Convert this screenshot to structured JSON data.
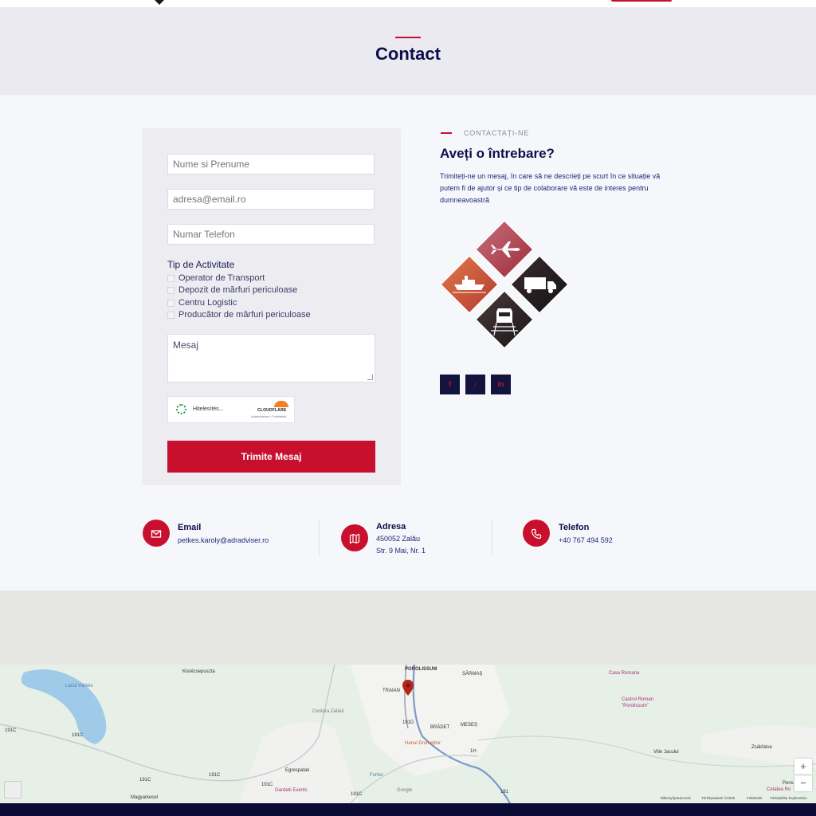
{
  "hero": {
    "title": "Contact"
  },
  "form": {
    "name_placeholder": "Nume si Prenume",
    "email_placeholder": "adresa@email.ro",
    "phone_placeholder": "Numar Telefon",
    "activity_label": "Tip de Activitate",
    "activities": [
      "Operator de Transport",
      "Depozit de mărfuri periculoase",
      "Centru Logistic",
      "Producător de mărfuri periculoase"
    ],
    "message_placeholder": "Mesaj",
    "captcha_text": "Hitelesítés...",
    "captcha_brand": "CLOUDFLARE",
    "captcha_links": "Adatvédelem • Feltételek",
    "submit_label": "Trimite Mesaj"
  },
  "contact_intro": {
    "kicker": "CONTACTAȚI-NE",
    "heading": "Aveți o întrebare?",
    "description": "Trimiteți-ne un mesaj, în care să ne descrieți pe scurt în ce situație vă putem fi de ajutor și ce tip de colaborare vă este de interes pentru dumneavoastră"
  },
  "social": [
    {
      "name": "facebook-icon",
      "glyph": "f"
    },
    {
      "name": "tiktok-icon",
      "glyph": "♪"
    },
    {
      "name": "linkedin-icon",
      "glyph": "in"
    }
  ],
  "info": {
    "email": {
      "title": "Email",
      "value": "petkes.karoly@adradviser.ro"
    },
    "address": {
      "title": "Adresa",
      "line1": "450052 Zalău",
      "line2": "Str. 9 Mai, Nr. 1"
    },
    "phone": {
      "title": "Telefon",
      "value": "+40 767 494 592"
    }
  },
  "map": {
    "labels": {
      "kisrecsepuszta": "Kisrécsepuszta",
      "lacul_varkes": "Lacul Várkés",
      "porolissum": "POROLISSUM",
      "sarmas": "ȘĂRMAȘ",
      "traian": "TRAIAN",
      "bradet": "BRĂDET",
      "meses": "MESEȘ",
      "casa_romana": "Casa Romana",
      "castrul": "Castrul Roman \"Porolissum\"",
      "hanul": "Hanul Drumeților",
      "viile": "Viile Jacului",
      "zsakfalva": "Zsákfalva",
      "egrespatak": "Egrespatak",
      "fortec": "Fortec",
      "gardelli": "Gardelli Events",
      "magyarkecel": "Magyarkecel",
      "google": "Google",
      "pens": "Pens",
      "cetatea": "Cetatea Ro",
      "centura": "Centura Zalăul"
    },
    "roads": [
      "191C",
      "191C",
      "191C",
      "191C",
      "191C",
      "191C",
      "191D",
      "1H",
      "191"
    ],
    "zoom_in": "+",
    "zoom_out": "−",
    "attributions": [
      "Billentyűparancsok",
      "Térképadatok ©2025",
      "Feltételek",
      "Térképhiba bejelentése"
    ]
  },
  "colors": {
    "accent": "#c8102e",
    "navy": "#0e0f4a",
    "footer": "#0b0c36"
  }
}
